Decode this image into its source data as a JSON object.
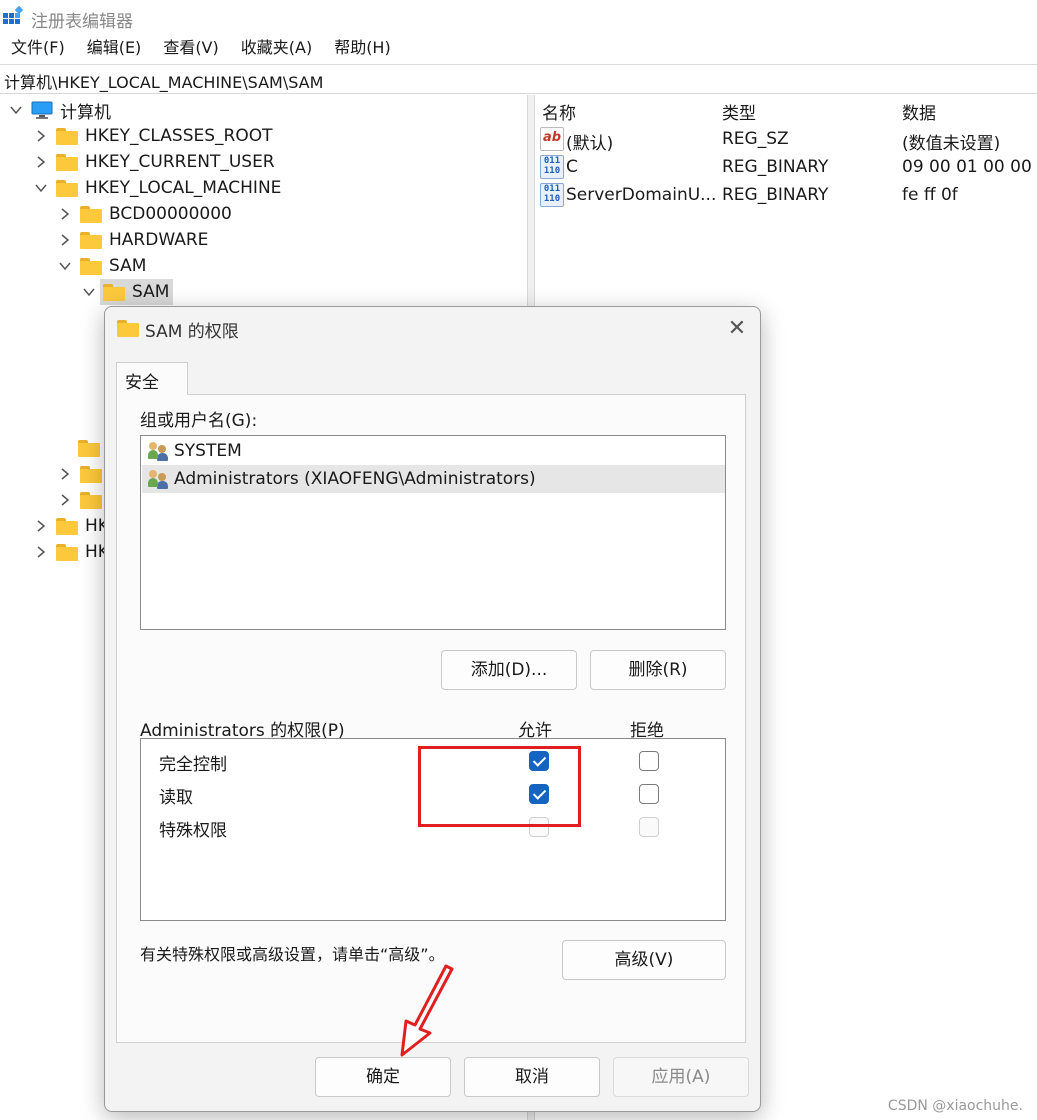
{
  "window": {
    "title": "注册表编辑器"
  },
  "menu": [
    "文件(F)",
    "编辑(E)",
    "查看(V)",
    "收藏夹(A)",
    "帮助(H)"
  ],
  "address": "计算机\\HKEY_LOCAL_MACHINE\\SAM\\SAM",
  "tree": {
    "root": "计算机",
    "hkcr": "HKEY_CLASSES_ROOT",
    "hkcu": "HKEY_CURRENT_USER",
    "hklm": "HKEY_LOCAL_MACHINE",
    "bcd": "BCD00000000",
    "hardware": "HARDWARE",
    "sam": "SAM",
    "sam_sub": "SAM",
    "hk_partial_1": "HK",
    "hk_partial_2": "HK"
  },
  "values_list": {
    "headers": {
      "name": "名称",
      "type": "类型",
      "data": "数据"
    },
    "rows": [
      {
        "icon": "string-value-icon",
        "name": "(默认)",
        "type": "REG_SZ",
        "data": "(数值未设置)"
      },
      {
        "icon": "binary-value-icon",
        "name": "C",
        "type": "REG_BINARY",
        "data": "09 00 01 00 00"
      },
      {
        "icon": "binary-value-icon",
        "name": "ServerDomainU...",
        "type": "REG_BINARY",
        "data": "fe ff 0f"
      }
    ]
  },
  "dialog": {
    "title": "SAM 的权限",
    "tab": "安全",
    "group_label": "组或用户名(G):",
    "users": [
      {
        "name": "SYSTEM",
        "selected": false
      },
      {
        "name": "Administrators (XIAOFENG\\Administrators)",
        "selected": true
      }
    ],
    "add_button": "添加(D)...",
    "remove_button": "删除(R)",
    "perm_header": "Administrators 的权限(P)",
    "allow_header": "允许",
    "deny_header": "拒绝",
    "permissions": [
      {
        "name": "完全控制",
        "allow": true,
        "deny": false,
        "enabled": true
      },
      {
        "name": "读取",
        "allow": true,
        "deny": false,
        "enabled": true
      },
      {
        "name": "特殊权限",
        "allow": false,
        "deny": false,
        "enabled": false
      }
    ],
    "advanced_hint": "有关特殊权限或高级设置，请单击“高级”。",
    "advanced_button": "高级(V)",
    "ok_button": "确定",
    "cancel_button": "取消",
    "apply_button": "应用(A)"
  },
  "watermark": "CSDN @xiaochuhe.",
  "colors": {
    "highlight": "#e02020",
    "checkbox": "#1565c0",
    "folder": "#fcc93d"
  }
}
